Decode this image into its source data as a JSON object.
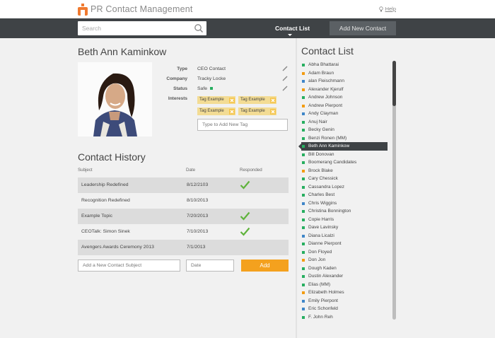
{
  "app": {
    "title": "PR Contact Management",
    "help_label": "Help"
  },
  "nav": {
    "search_placeholder": "Search",
    "contact_list_label": "Contact List",
    "add_contact_label": "Add New Contact"
  },
  "contact": {
    "name": "Beth Ann Kaminkow",
    "type_label": "Type",
    "type_value": "CEO Contact",
    "company_label": "Company",
    "company_value": "Tracky Locke",
    "status_label": "Status",
    "status_value": "Safe",
    "interests_label": "Interests",
    "tags": [
      "Tag Example",
      "Tag Example",
      "Tag Example",
      "Tag Example"
    ],
    "tag_placeholder": "Type to Add New Tag"
  },
  "history": {
    "title": "Contact History",
    "headers": {
      "subject": "Subject",
      "date": "Date",
      "responded": "Responded"
    },
    "rows": [
      {
        "subject": "Leadership Redefined",
        "date": "8/12/2103",
        "responded": true
      },
      {
        "subject": "Recognition Redefined",
        "date": "8/10/2013",
        "responded": false
      },
      {
        "subject": "Example Topic",
        "date": "7/20/2013",
        "responded": true
      },
      {
        "subject": "CEOTalk: Simon Sinek",
        "date": "7/10/2013",
        "responded": true
      },
      {
        "subject": "Avengers Awards Ceremony 2013",
        "date": "7/1/2013",
        "responded": false
      }
    ],
    "subject_placeholder": "Add a New Contact Subject",
    "date_placeholder": "Date",
    "add_label": "Add"
  },
  "contact_list": {
    "title": "Contact List",
    "colors": {
      "green": "#27ae60",
      "orange": "#f39c12",
      "blue": "#3f86c8"
    },
    "items": [
      {
        "name": "Abha Bhattarai",
        "color": "green"
      },
      {
        "name": "Adam Braun",
        "color": "orange"
      },
      {
        "name": "alan Fleischmann",
        "color": "blue"
      },
      {
        "name": "Alexander Kjerulf",
        "color": "orange"
      },
      {
        "name": "Andrew Johnson",
        "color": "green"
      },
      {
        "name": "Andrew Pierpont",
        "color": "orange"
      },
      {
        "name": "Andy Clayman",
        "color": "blue"
      },
      {
        "name": "Anuj Nair",
        "color": "green"
      },
      {
        "name": "Becky Genin",
        "color": "green"
      },
      {
        "name": "Benzi Ronen (MM)",
        "color": "green"
      },
      {
        "name": "Beth Ann Kaminkow",
        "color": "green",
        "selected": true
      },
      {
        "name": "Bill Donovan",
        "color": "green"
      },
      {
        "name": "Boomerang Candidates",
        "color": "green"
      },
      {
        "name": "Brock Blake",
        "color": "orange"
      },
      {
        "name": "Cary Chessick",
        "color": "green"
      },
      {
        "name": "Cassandra Lopez",
        "color": "green"
      },
      {
        "name": "Charles Best",
        "color": "green"
      },
      {
        "name": "Chris Wiggins",
        "color": "blue"
      },
      {
        "name": "Christina Bonnington",
        "color": "green"
      },
      {
        "name": "Copie Harris",
        "color": "green"
      },
      {
        "name": "Dave Lavinsky",
        "color": "green"
      },
      {
        "name": "Diana Licalzi",
        "color": "blue"
      },
      {
        "name": "Dianne Pierpont",
        "color": "green"
      },
      {
        "name": "Don Floyed",
        "color": "green"
      },
      {
        "name": "Don Jon",
        "color": "orange"
      },
      {
        "name": "Dough Kaden",
        "color": "green"
      },
      {
        "name": "Dustin Alexander",
        "color": "green"
      },
      {
        "name": "Elias (MM)",
        "color": "green"
      },
      {
        "name": "Elizabeth Holmes",
        "color": "orange"
      },
      {
        "name": "Emily Pierpont",
        "color": "blue"
      },
      {
        "name": "Eric Schonfeld",
        "color": "blue"
      },
      {
        "name": "F. John Reh",
        "color": "green"
      }
    ]
  }
}
